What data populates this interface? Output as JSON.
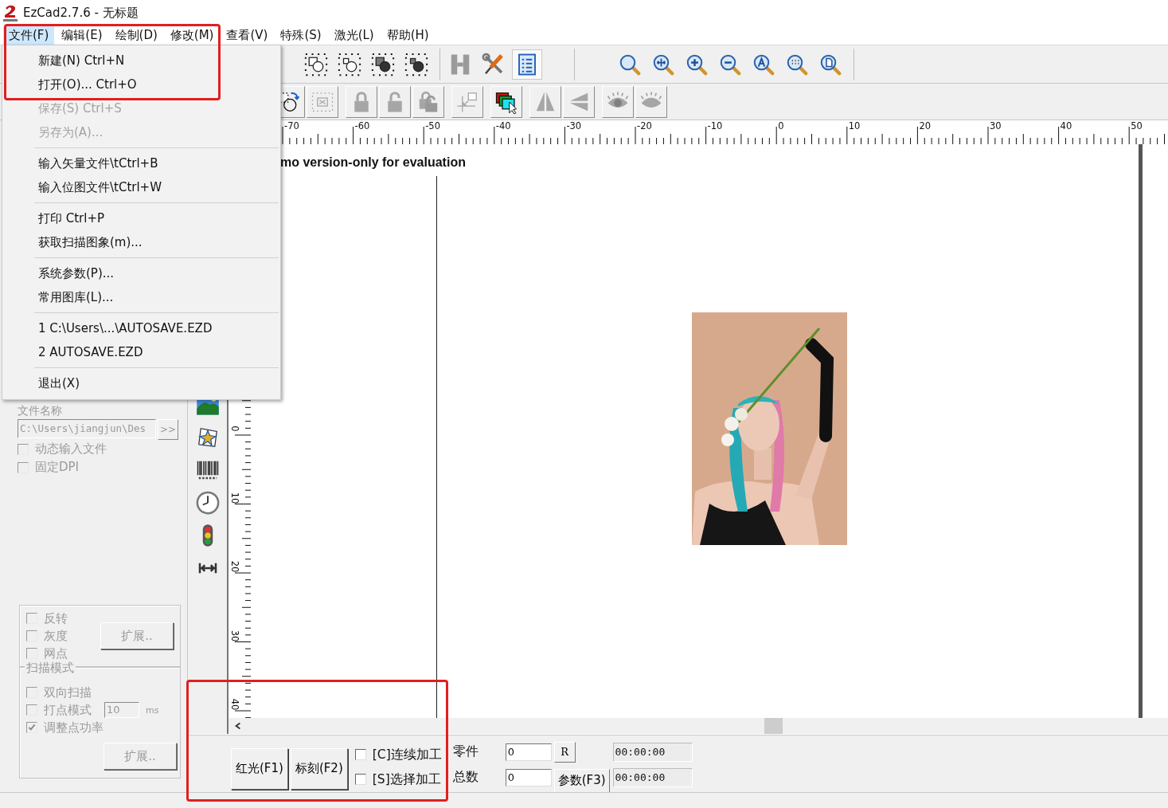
{
  "window": {
    "title": "EzCad2.7.6 - 无标题"
  },
  "menu_bar": [
    {
      "label": "文件(F)",
      "selected": true
    },
    {
      "label": "编辑(E)",
      "selected": false
    },
    {
      "label": "绘制(D)",
      "selected": false
    },
    {
      "label": "修改(M)",
      "selected": false
    },
    {
      "label": "查看(V)",
      "selected": false
    },
    {
      "label": "特殊(S)",
      "selected": false
    },
    {
      "label": "激光(L)",
      "selected": false
    },
    {
      "label": "帮助(H)",
      "selected": false
    }
  ],
  "file_menu": [
    {
      "kind": "item",
      "label": "新建(N) Ctrl+N",
      "disabled": false
    },
    {
      "kind": "item",
      "label": "打开(O)... Ctrl+O",
      "disabled": false
    },
    {
      "kind": "item",
      "label": "保存(S) Ctrl+S",
      "disabled": true
    },
    {
      "kind": "item",
      "label": "另存为(A)...",
      "disabled": true
    },
    {
      "kind": "separator"
    },
    {
      "kind": "item",
      "label": "输入矢量文件\\tCtrl+B",
      "disabled": false
    },
    {
      "kind": "item",
      "label": "输入位图文件\\tCtrl+W",
      "disabled": false
    },
    {
      "kind": "separator"
    },
    {
      "kind": "item",
      "label": "打印 Ctrl+P",
      "disabled": false
    },
    {
      "kind": "item",
      "label": "获取扫描图象(m)...",
      "disabled": false
    },
    {
      "kind": "separator"
    },
    {
      "kind": "item",
      "label": "系统参数(P)...",
      "disabled": false
    },
    {
      "kind": "item",
      "label": "常用图库(L)...",
      "disabled": false
    },
    {
      "kind": "separator"
    },
    {
      "kind": "item",
      "label": "1 C:\\Users\\...\\AUTOSAVE.EZD",
      "disabled": false
    },
    {
      "kind": "item",
      "label": "2 AUTOSAVE.EZD",
      "disabled": false
    },
    {
      "kind": "separator"
    },
    {
      "kind": "item",
      "label": "退出(X)",
      "disabled": false
    }
  ],
  "toolbar_top": [
    {
      "buttons": [
        {
          "kind": "group",
          "selected": false
        },
        {
          "kind": "ungroup",
          "selected": false
        },
        {
          "kind": "group-filled",
          "selected": false
        },
        {
          "kind": "ungroup-filled",
          "selected": false
        }
      ]
    },
    {
      "buttons": [
        {
          "kind": "hatch",
          "selected": false
        },
        {
          "kind": "tools",
          "selected": false
        },
        {
          "kind": "list",
          "selected": true
        }
      ]
    },
    {
      "buttons": [
        {
          "kind": "zoom",
          "selected": false
        },
        {
          "kind": "zoom-pan",
          "selected": false
        },
        {
          "kind": "zoom-in",
          "selected": false
        },
        {
          "kind": "zoom-out",
          "selected": false
        },
        {
          "kind": "zoom-all",
          "selected": false
        },
        {
          "kind": "zoom-dots",
          "selected": false
        },
        {
          "kind": "zoom-page",
          "selected": false
        }
      ]
    }
  ],
  "toolbar_second": [
    {
      "buttons": [
        {
          "kind": "rotate",
          "disabled": false
        },
        {
          "kind": "dotted-box",
          "disabled": true
        }
      ]
    },
    {
      "buttons": [
        {
          "kind": "lock",
          "disabled": true
        },
        {
          "kind": "unlock",
          "disabled": true
        },
        {
          "kind": "locks",
          "disabled": true
        }
      ]
    },
    {
      "buttons": [
        {
          "kind": "corner",
          "disabled": true
        }
      ]
    },
    {
      "buttons": [
        {
          "kind": "layers",
          "disabled": false
        }
      ]
    },
    {
      "buttons": [
        {
          "kind": "mirror-h",
          "disabled": true
        },
        {
          "kind": "mirror-v",
          "disabled": true
        }
      ]
    },
    {
      "buttons": [
        {
          "kind": "eye",
          "disabled": true
        },
        {
          "kind": "eye-closed",
          "disabled": true
        }
      ]
    }
  ],
  "left_panel": {
    "disabled": true,
    "file_name_label": "文件名称",
    "file_path": "C:\\Users\\jiangjun\\Des",
    "browse_button": ">>",
    "file_options": [
      {
        "label": "动态输入文件",
        "checked": false
      },
      {
        "label": "固定DPI",
        "checked": false
      }
    ],
    "image_options": [
      {
        "label": "反转",
        "checked": false
      },
      {
        "label": "灰度",
        "checked": false
      },
      {
        "label": "网点",
        "checked": false
      }
    ],
    "image_extend_button": "扩展..",
    "scan_mode": {
      "title": "扫描模式",
      "options": [
        {
          "kind": "check",
          "label": "双向扫描",
          "checked": false
        },
        {
          "kind": "check-value",
          "label": "打点模式",
          "checked": false,
          "value": "10",
          "unit": "ms"
        },
        {
          "kind": "check",
          "label": "调整点功率",
          "checked": true
        }
      ],
      "extend_button": "扩展.."
    }
  },
  "canvas": {
    "notice": "mo version-only for evaluation",
    "h_ruler": [
      "-70",
      "-60",
      "-50",
      "-40",
      "-30",
      "-20",
      "-10",
      "0",
      "10",
      "20",
      "30",
      "40",
      "50"
    ],
    "v_ruler": [
      "0",
      "10",
      "20",
      "30",
      "40"
    ],
    "image": {
      "kind": "picture"
    }
  },
  "bottom_bar": {
    "red_light_button": "红光(F1)",
    "mark_button": "标刻(F2)",
    "options": [
      {
        "label": "[C]连续加工",
        "checked": false
      },
      {
        "label": "[S]选择加工",
        "checked": false
      }
    ],
    "parts_label": "零件",
    "parts_value": "0",
    "reset_button": "R",
    "total_label": "总数",
    "total_value": "0",
    "params_button": "参数(F3)",
    "times": [
      "00:00:00",
      "00:00:00"
    ]
  }
}
